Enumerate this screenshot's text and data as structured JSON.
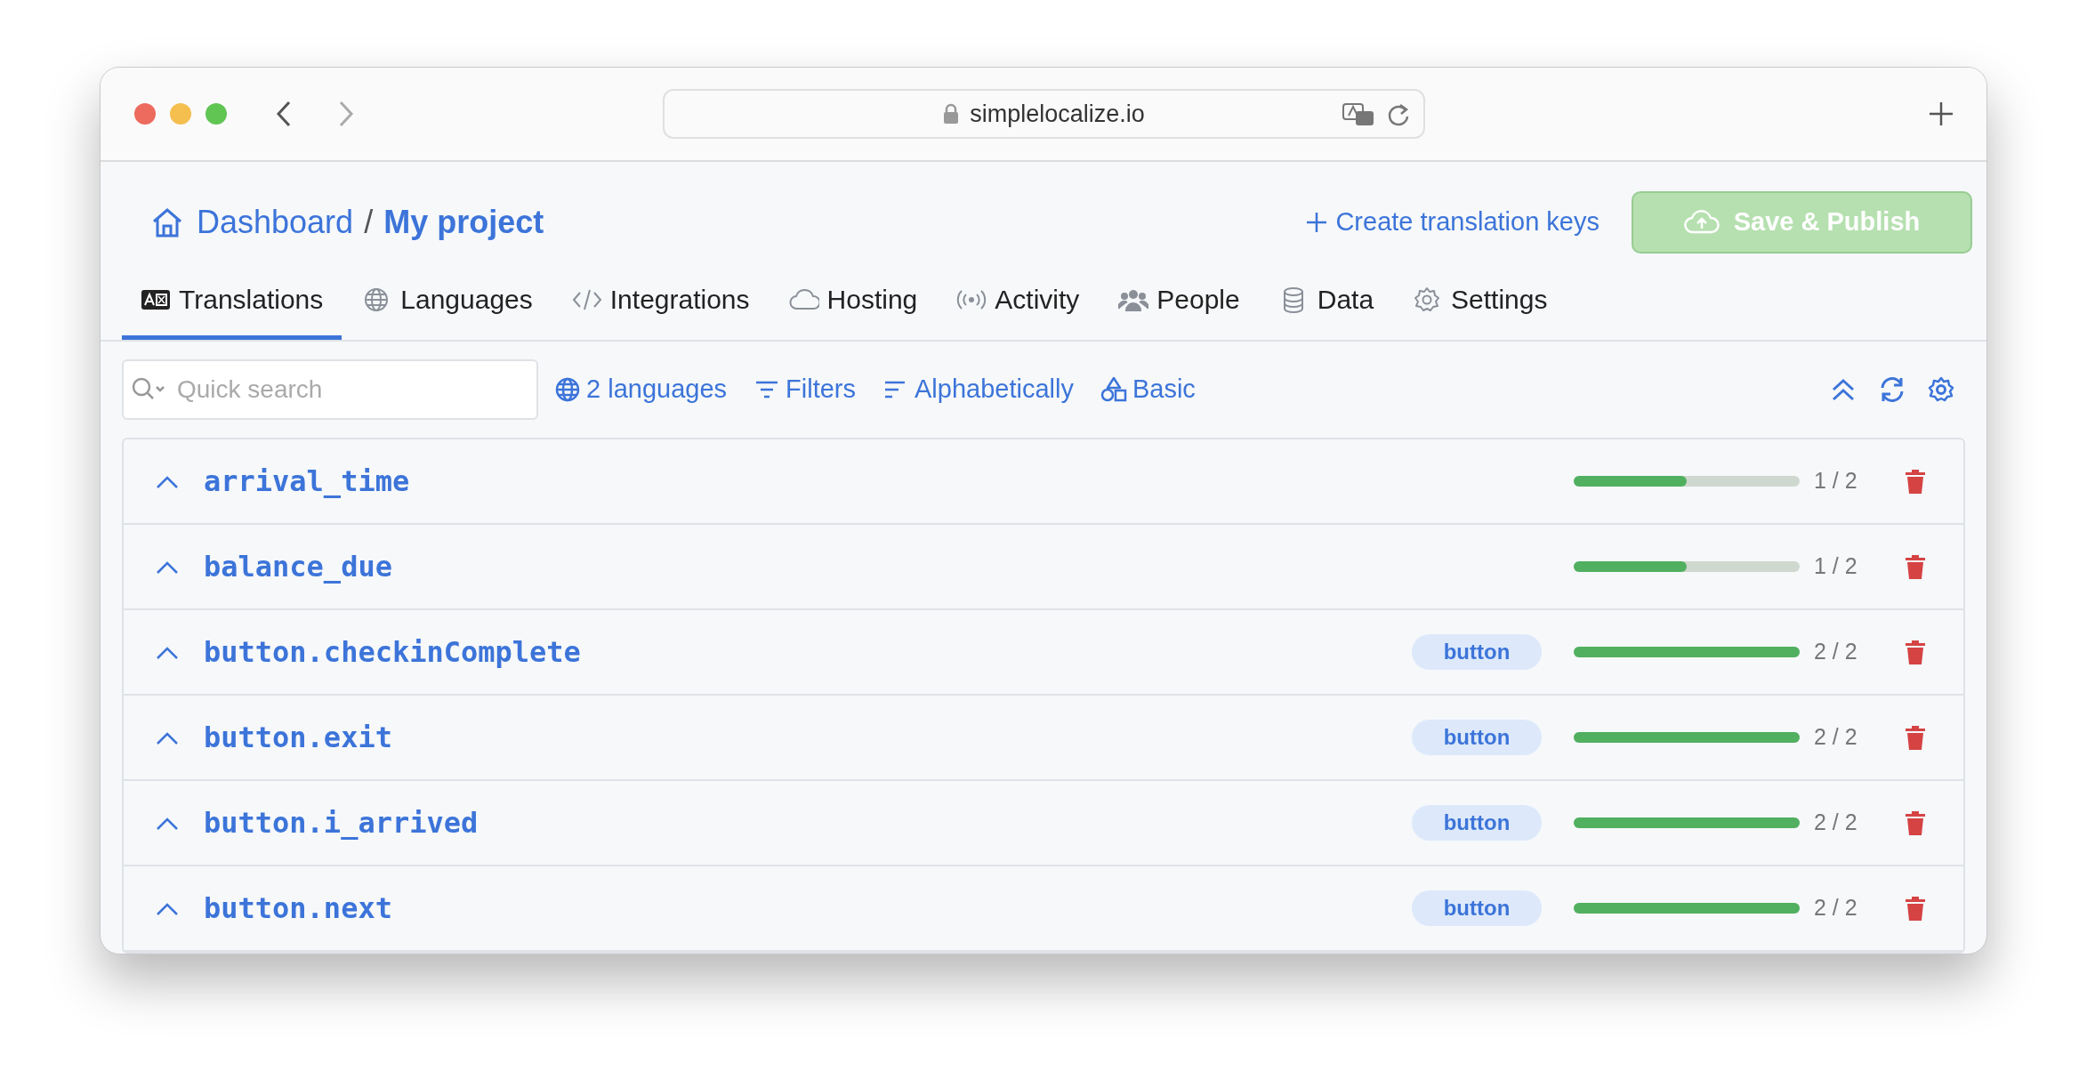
{
  "browser": {
    "url": "simplelocalize.io"
  },
  "breadcrumb_separator": "/",
  "breadcrumb": [
    {
      "label": "Dashboard",
      "current": false
    },
    {
      "label": "My project",
      "current": true
    }
  ],
  "actions": {
    "create": "Create translation keys",
    "publish": {
      "label": "Save & Publish",
      "disabled": true
    }
  },
  "tabs": [
    {
      "label": "Translations",
      "selected": true
    },
    {
      "label": "Languages",
      "selected": false
    },
    {
      "label": "Integrations",
      "selected": false
    },
    {
      "label": "Hosting",
      "selected": false
    },
    {
      "label": "Activity",
      "selected": false
    },
    {
      "label": "People",
      "selected": false
    },
    {
      "label": "Data",
      "selected": false
    },
    {
      "label": "Settings",
      "selected": false
    }
  ],
  "toolbar": {
    "search": {
      "placeholder": "Quick search"
    },
    "buttons": [
      "2 languages",
      "Filters",
      "Alphabetically",
      "Basic"
    ]
  },
  "keys": [
    {
      "name": "arrival_time",
      "level": 0.5,
      "progress": "1 / 2"
    },
    {
      "name": "balance_due",
      "level": 0.5,
      "progress": "1 / 2"
    },
    {
      "name": "button.checkinComplete",
      "tag": "button",
      "level": 1,
      "progress": "2 / 2"
    },
    {
      "name": "button.exit",
      "tag": "button",
      "level": 1,
      "progress": "2 / 2"
    },
    {
      "name": "button.i_arrived",
      "tag": "button",
      "level": 1,
      "progress": "2 / 2"
    },
    {
      "name": "button.next",
      "tag": "button",
      "level": 1,
      "progress": "2 / 2"
    }
  ]
}
